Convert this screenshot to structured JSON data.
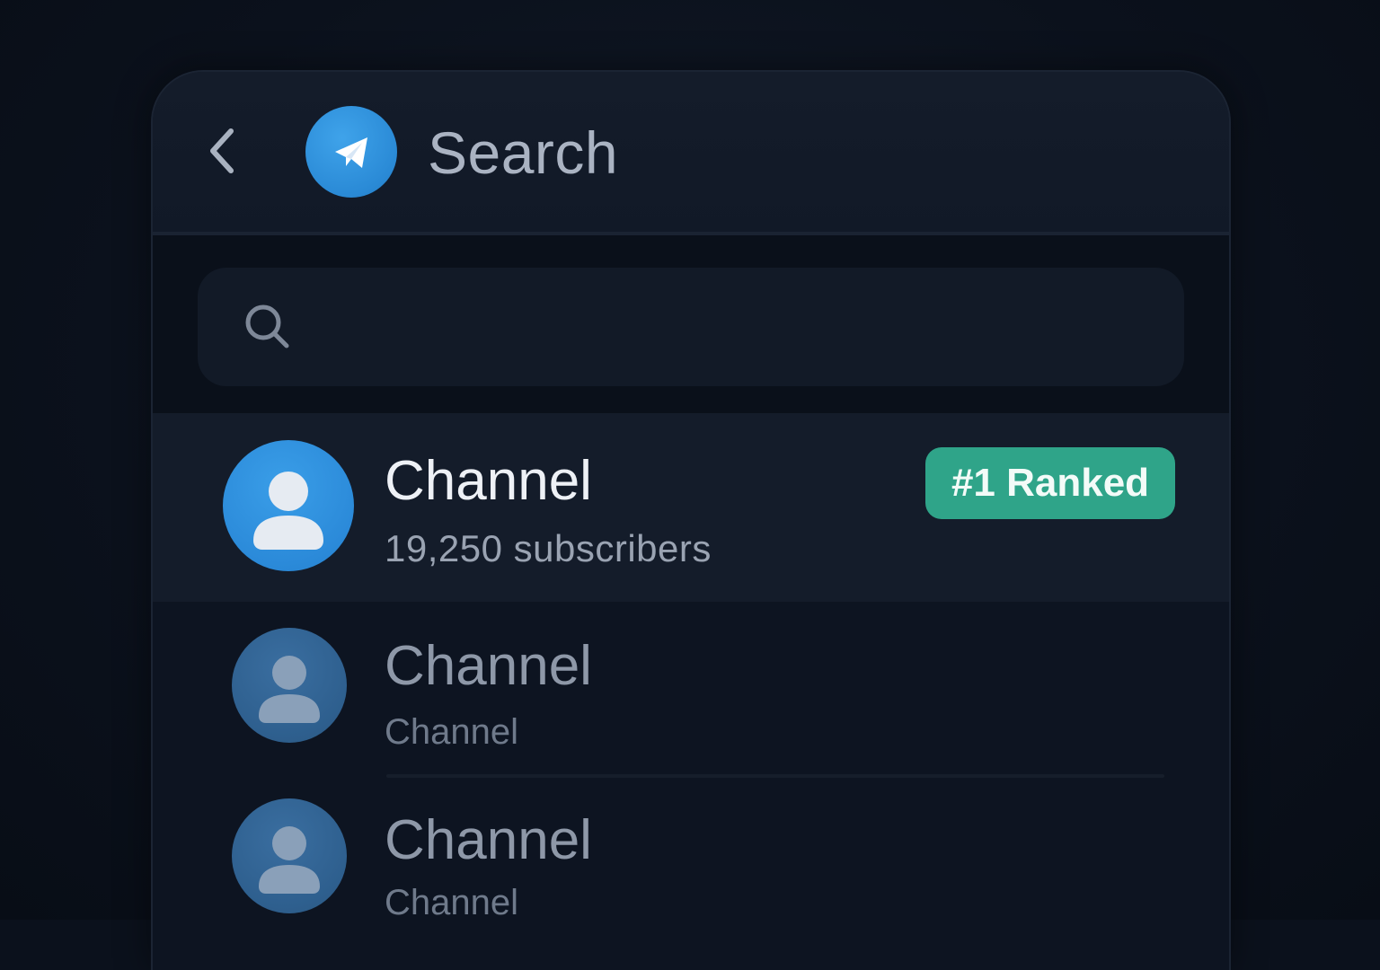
{
  "header": {
    "title": "Search",
    "back_icon": "chevron-left-icon",
    "logo_icon": "paper-plane-icon"
  },
  "search": {
    "placeholder": "",
    "value": "",
    "icon": "search-icon"
  },
  "results": [
    {
      "title": "Channel",
      "subtitle": "19,250 subscribers",
      "badge": "#1 Ranked",
      "highlighted": true
    },
    {
      "title": "Channel",
      "subtitle": "Channel",
      "highlighted": false
    },
    {
      "title": "Channel",
      "subtitle": "Channel",
      "highlighted": false
    }
  ],
  "colors": {
    "accent": "#2b8ad9",
    "badge": "#2fa489",
    "background": "#0b111c"
  }
}
